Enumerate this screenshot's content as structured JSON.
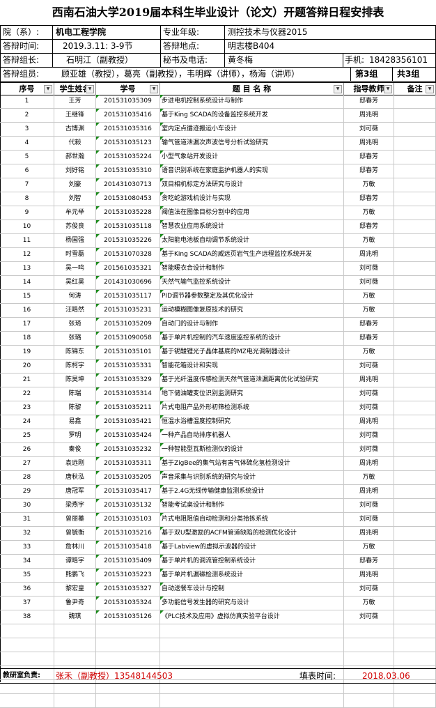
{
  "title": "西南石油大学2019届本科生毕业设计（论文）开题答辩日程安排表",
  "info": {
    "college_label": "院（系）:",
    "college_value": "机电工程学院",
    "major_label": "专业年级:",
    "major_value": "测控技术与仪器2015",
    "time_label": "答辩时间:",
    "time_value": "2019.3.11:  3-9节",
    "place_label": "答辩地点:",
    "place_value": "明志楼B404",
    "leader_label": "答辩组长:",
    "leader_value": "石明江（副教授）",
    "secretary_label": "秘书及电话:",
    "secretary_value": "黄冬梅",
    "phone_label": "手机:",
    "phone_value": "18428356101",
    "members_label": "答辩组员:",
    "members_value": "顾亚雄（教授），葛亮（副教授），韦明辉（讲师），杨海（讲师）",
    "group_value": "第3组",
    "group_total": "共3组"
  },
  "headers": [
    "序号",
    "学生姓名",
    "学号",
    "题 目 名 称",
    "指导教师",
    "备注"
  ],
  "rows": [
    {
      "no": "1",
      "name": "王芳",
      "id": "201531035309",
      "topic": "步进电机控制系统设计与制作",
      "advisor": "邸春芳"
    },
    {
      "no": "2",
      "name": "王继锋",
      "id": "201531035416",
      "topic": "基于King SCADA的设备监控系统开发",
      "advisor": "周兆明"
    },
    {
      "no": "3",
      "name": "古博渊",
      "id": "201531035316",
      "topic": "室内定点循迹搬运小车设计",
      "advisor": "刘可薇"
    },
    {
      "no": "4",
      "name": "代毅",
      "id": "201531035123",
      "topic": "输气管道泄漏次声波信号分析试验研究",
      "advisor": "周兆明"
    },
    {
      "no": "5",
      "name": "郝世瀚",
      "id": "201531035224",
      "topic": "小型气象站开发设计",
      "advisor": "邸春芳"
    },
    {
      "no": "6",
      "name": "刘好铭",
      "id": "201531035310",
      "topic": "语音识别系统在家庭监护机器人的实现",
      "advisor": "邸春芳"
    },
    {
      "no": "7",
      "name": "刘豪",
      "id": "201431030713",
      "topic": "双目相机标定方法研究与设计",
      "advisor": "万敏"
    },
    {
      "no": "8",
      "name": "刘智",
      "id": "201531080453",
      "topic": "贪吃蛇游戏机设计与实现",
      "advisor": "邸春芳"
    },
    {
      "no": "9",
      "name": "牟元举",
      "id": "201531035228",
      "topic": "阈值法在图像目标分割中的应用",
      "advisor": "万敏"
    },
    {
      "no": "10",
      "name": "苏俊良",
      "id": "201531035118",
      "topic": "智慧农业应用系统设计",
      "advisor": "邸春芳"
    },
    {
      "no": "11",
      "name": "杨国强",
      "id": "201531035226",
      "topic": "太阳能电池板自动调节系统设计",
      "advisor": "万敏"
    },
    {
      "no": "12",
      "name": "时雪磊",
      "id": "201531070328",
      "topic": "基于King SCADA的威远页岩气生产远程监控系统开发",
      "advisor": "周兆明"
    },
    {
      "no": "13",
      "name": "吴一鸣",
      "id": "201561035321",
      "topic": "智能暖衣合设计和制作",
      "advisor": "刘可薇"
    },
    {
      "no": "14",
      "name": "吴红昊",
      "id": "201431030696",
      "topic": "天然气输气监控系统设计",
      "advisor": "刘可薇"
    },
    {
      "no": "15",
      "name": "何涛",
      "id": "201531035117",
      "topic": "PID调节器参数整定及其优化设计",
      "advisor": "万敏"
    },
    {
      "no": "16",
      "name": "汪皓然",
      "id": "201531035231",
      "topic": "运动模糊图像复原技术的研究",
      "advisor": "万敏"
    },
    {
      "no": "17",
      "name": "张琦",
      "id": "201531035209",
      "topic": "自动门的设计与制作",
      "advisor": "邸春芳"
    },
    {
      "no": "18",
      "name": "张璐",
      "id": "201531090058",
      "topic": "基于单片机控制的汽车速度监控系统的设计",
      "advisor": "邸春芳"
    },
    {
      "no": "19",
      "name": "陈锦东",
      "id": "201531035101",
      "topic": "基于铌酸锂光子晶体基底的MZ电光调制器设计",
      "advisor": "万敏"
    },
    {
      "no": "20",
      "name": "陈柯宇",
      "id": "201531035331",
      "topic": "智能花箱设计和实现",
      "advisor": "刘可薇"
    },
    {
      "no": "21",
      "name": "陈昊坤",
      "id": "201531035329",
      "topic": "基于光纤温度传感检测天然气管道泄漏距离优化试验研究",
      "advisor": "周兆明"
    },
    {
      "no": "22",
      "name": "陈瑞",
      "id": "201531035314",
      "topic": "地下储油罐变位识别监测研究",
      "advisor": "刘可薇"
    },
    {
      "no": "23",
      "name": "陈黎",
      "id": "201531035211",
      "topic": "片式电阻产品外形初筛检测系统",
      "advisor": "刘可薇"
    },
    {
      "no": "24",
      "name": "易鑫",
      "id": "201531035421",
      "topic": "恒温水浴槽温度控制研究",
      "advisor": "周兆明"
    },
    {
      "no": "25",
      "name": "罗明",
      "id": "201531035424",
      "topic": "一种产品自动排序机器人",
      "advisor": "刘可薇"
    },
    {
      "no": "26",
      "name": "秦俊",
      "id": "201531035232",
      "topic": "一种智能型瓦斯检测仪的设计",
      "advisor": "刘可薇"
    },
    {
      "no": "27",
      "name": "袁远刚",
      "id": "201531035311",
      "topic": "基于ZigBee的集气站有害气体硫化氢检测设计",
      "advisor": "周兆明"
    },
    {
      "no": "28",
      "name": "唐秋泓",
      "id": "201531035205",
      "topic": "声音采集与识别系统的研究与设计",
      "advisor": "万敏"
    },
    {
      "no": "29",
      "name": "唐冠军",
      "id": "201531035417",
      "topic": "基于2.4G无线传输健康监测系统设计",
      "advisor": "周兆明"
    },
    {
      "no": "30",
      "name": "梁燕宇",
      "id": "201531035132",
      "topic": "智能考试桌设计和制作",
      "advisor": "刘可薇"
    },
    {
      "no": "31",
      "name": "曾丽蓁",
      "id": "201531035103",
      "topic": "片式电阻阻值自动检测和分类拾拣系统",
      "advisor": "刘可薇"
    },
    {
      "no": "32",
      "name": "曾毓衡",
      "id": "201531035216",
      "topic": "基于双U型激励的ACFM管道缺陷的检测优化设计",
      "advisor": "周兆明"
    },
    {
      "no": "33",
      "name": "詹林川",
      "id": "201531035418",
      "topic": "基于Labview的虚拟示波器的设计",
      "advisor": "万敏"
    },
    {
      "no": "34",
      "name": "谭皓宇",
      "id": "201531035409",
      "topic": "基于单片机的调流管控制系统设计",
      "advisor": "邸春芳"
    },
    {
      "no": "35",
      "name": "熊鹏飞",
      "id": "201531035223",
      "topic": "基于单片机漏磁检测系统设计",
      "advisor": "周兆明"
    },
    {
      "no": "36",
      "name": "黎宏皇",
      "id": "201531035327",
      "topic": "自动送餐车设计与控制",
      "advisor": "刘可薇"
    },
    {
      "no": "37",
      "name": "鲁尹奇",
      "id": "201531035324",
      "topic": "多功能信号发生器的研究与设计",
      "advisor": "万敏"
    },
    {
      "no": "38",
      "name": "魏琪",
      "id": "201531035126",
      "topic": "《PLC技术及应用》虚拟仿真实验平台设计",
      "advisor": "刘可薇"
    }
  ],
  "empty_rows": 6,
  "footer": {
    "office_label": "教研室负责:",
    "office_value": "张禾（副教授）13548144503",
    "date_label": "填表时间:",
    "date_value": "2018.03.06"
  },
  "colors": {
    "accent_red": "#d00000",
    "marker_green": "#1a8a1a"
  },
  "icons": {
    "filter": "filter-dropdown-icon",
    "corner": "green-comment-triangle-icon"
  }
}
